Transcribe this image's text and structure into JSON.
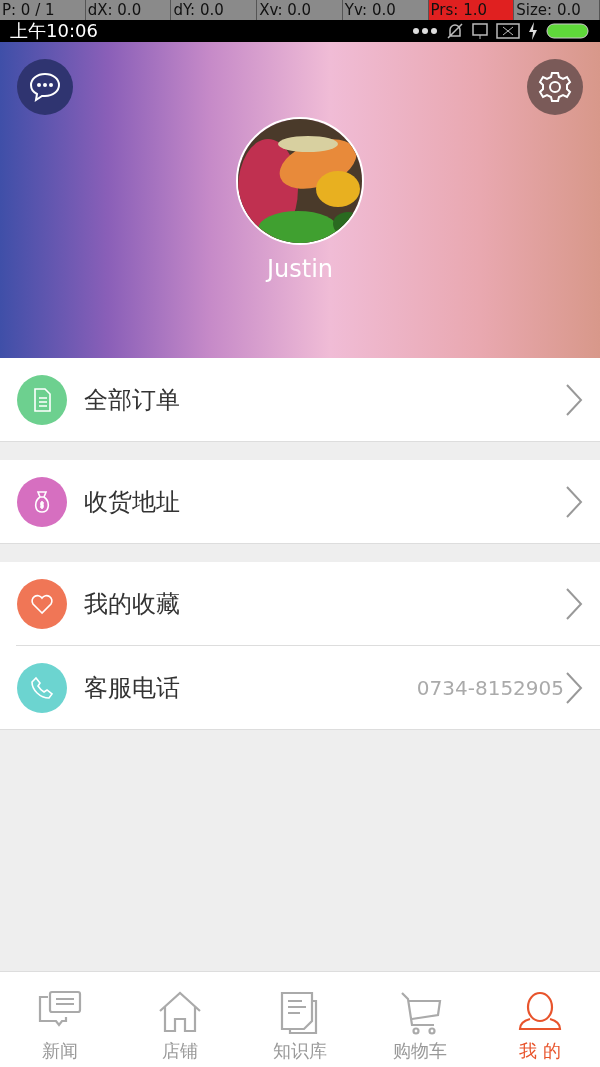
{
  "debug_overlay": [
    {
      "text": "P: 0 / 1",
      "highlighted": false
    },
    {
      "text": "dX: 0.0",
      "highlighted": false
    },
    {
      "text": "dY: 0.0",
      "highlighted": false
    },
    {
      "text": "Xv: 0.0",
      "highlighted": false
    },
    {
      "text": "Yv: 0.0",
      "highlighted": false
    },
    {
      "text": "Prs: 1.0",
      "highlighted": true
    },
    {
      "text": "Size: 0.0",
      "highlighted": false
    }
  ],
  "status_bar": {
    "time": "上午10:06"
  },
  "profile": {
    "username": "Justin"
  },
  "menu_groups": [
    {
      "items": [
        {
          "kind": "orders",
          "label": "全部订单",
          "color": "#6dd08f"
        }
      ]
    },
    {
      "items": [
        {
          "kind": "address",
          "label": "收货地址",
          "color": "#d66fc0"
        }
      ]
    },
    {
      "items": [
        {
          "kind": "favorites",
          "label": "我的收藏",
          "color": "#f07656"
        },
        {
          "kind": "phone",
          "label": "客服电话",
          "color": "#6cd4d0",
          "value": "0734-8152905"
        }
      ]
    }
  ],
  "tab_bar": [
    {
      "kind": "news",
      "label": "新闻",
      "selected": false
    },
    {
      "kind": "store",
      "label": "店铺",
      "selected": false
    },
    {
      "kind": "knowledge",
      "label": "知识库",
      "selected": false
    },
    {
      "kind": "cart",
      "label": "购物车",
      "selected": false
    },
    {
      "kind": "me",
      "label": "我 的",
      "selected": true
    }
  ]
}
